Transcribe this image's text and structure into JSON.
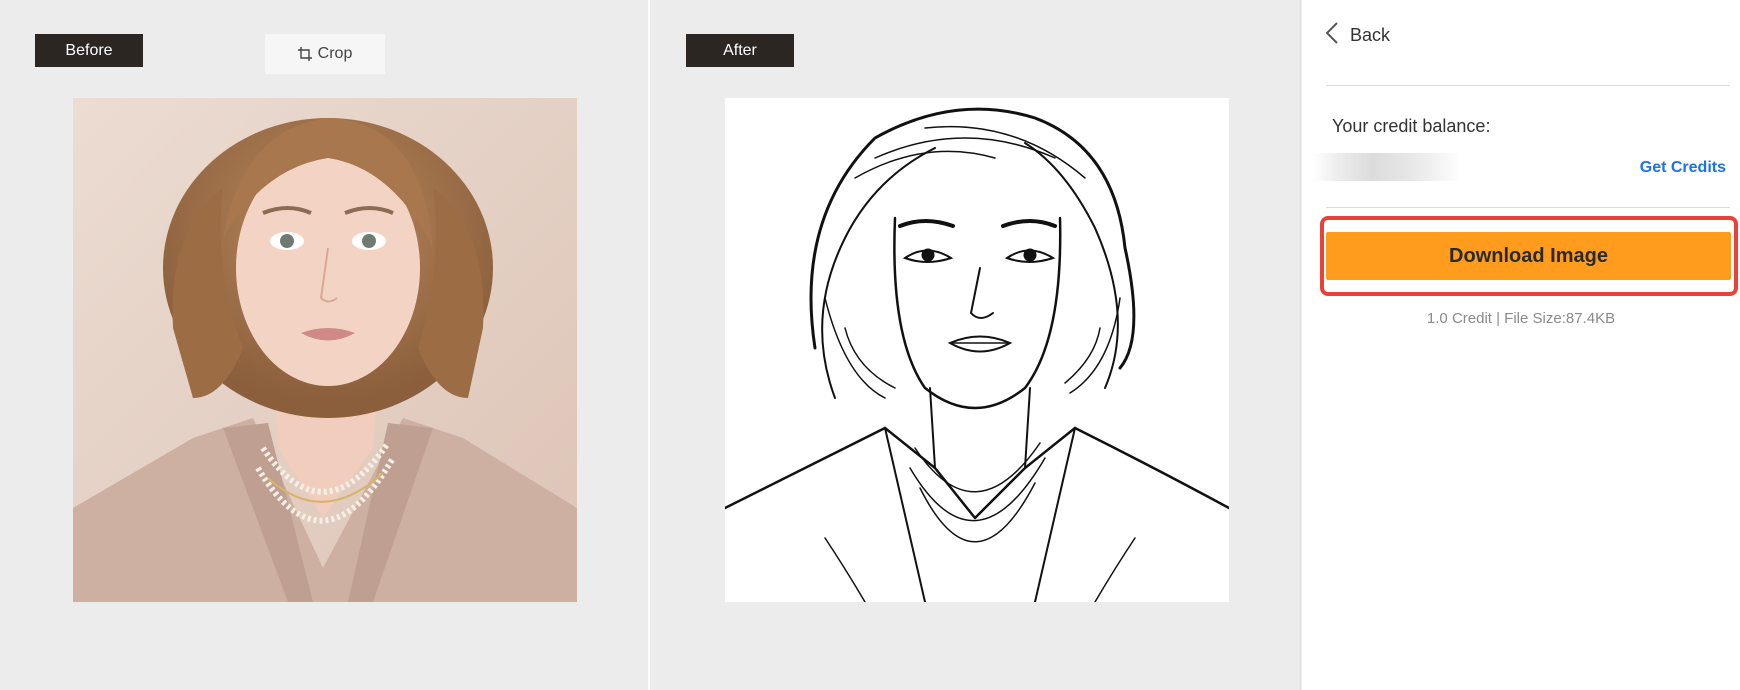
{
  "before_panel": {
    "tag": "Before",
    "crop_label": "Crop"
  },
  "after_panel": {
    "tag": "After"
  },
  "sidebar": {
    "back_label": "Back",
    "credit_label": "Your credit balance:",
    "get_credits_label": "Get Credits",
    "download_label": "Download Image",
    "download_meta": "1.0 Credit | File Size:87.4KB"
  },
  "colors": {
    "tag_bg": "#2c2623",
    "download_button": "#ff9c1d",
    "highlight_outline": "#e8423b",
    "link": "#1a73e8"
  },
  "icons": {
    "crop": "crop-icon",
    "back": "chevron-left-icon"
  }
}
